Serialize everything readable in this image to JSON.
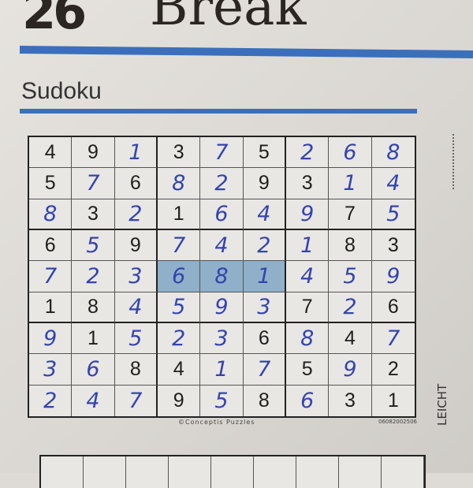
{
  "header": {
    "page_number": "26",
    "section_title": "Break",
    "subtitle": "Sudoku"
  },
  "puzzle": {
    "grid": [
      [
        4,
        9,
        1,
        3,
        7,
        5,
        2,
        6,
        8
      ],
      [
        5,
        7,
        6,
        8,
        2,
        9,
        3,
        1,
        4
      ],
      [
        8,
        3,
        2,
        1,
        6,
        4,
        9,
        7,
        5
      ],
      [
        6,
        5,
        9,
        7,
        4,
        2,
        1,
        8,
        3
      ],
      [
        7,
        2,
        3,
        6,
        8,
        1,
        4,
        5,
        9
      ],
      [
        1,
        8,
        4,
        5,
        9,
        3,
        7,
        2,
        6
      ],
      [
        9,
        1,
        5,
        2,
        3,
        6,
        8,
        4,
        7
      ],
      [
        3,
        6,
        8,
        4,
        1,
        7,
        5,
        9,
        2
      ],
      [
        2,
        4,
        7,
        9,
        5,
        8,
        6,
        3,
        1
      ]
    ],
    "given": [
      [
        1,
        1,
        0,
        1,
        0,
        1,
        0,
        0,
        0
      ],
      [
        1,
        0,
        1,
        0,
        0,
        1,
        1,
        0,
        0
      ],
      [
        0,
        1,
        0,
        1,
        0,
        0,
        0,
        1,
        0
      ],
      [
        1,
        0,
        1,
        0,
        0,
        0,
        0,
        1,
        1
      ],
      [
        0,
        0,
        0,
        0,
        0,
        0,
        0,
        0,
        0
      ],
      [
        1,
        1,
        0,
        0,
        0,
        0,
        1,
        0,
        1
      ],
      [
        0,
        1,
        0,
        0,
        0,
        1,
        0,
        1,
        0
      ],
      [
        0,
        0,
        1,
        1,
        0,
        0,
        1,
        0,
        1
      ],
      [
        0,
        0,
        0,
        1,
        0,
        1,
        0,
        1,
        1
      ]
    ],
    "highlighted_cells": [
      [
        5,
        4
      ],
      [
        5,
        5
      ],
      [
        5,
        6
      ]
    ],
    "highlight_color": "#8fb0c8",
    "handwriting_color": "#3344b0",
    "accent_color": "#3c6fbb"
  },
  "footer": {
    "copyright": "©Conceptis Puzzles",
    "code": "06082002506",
    "difficulty": "LEICHT"
  }
}
